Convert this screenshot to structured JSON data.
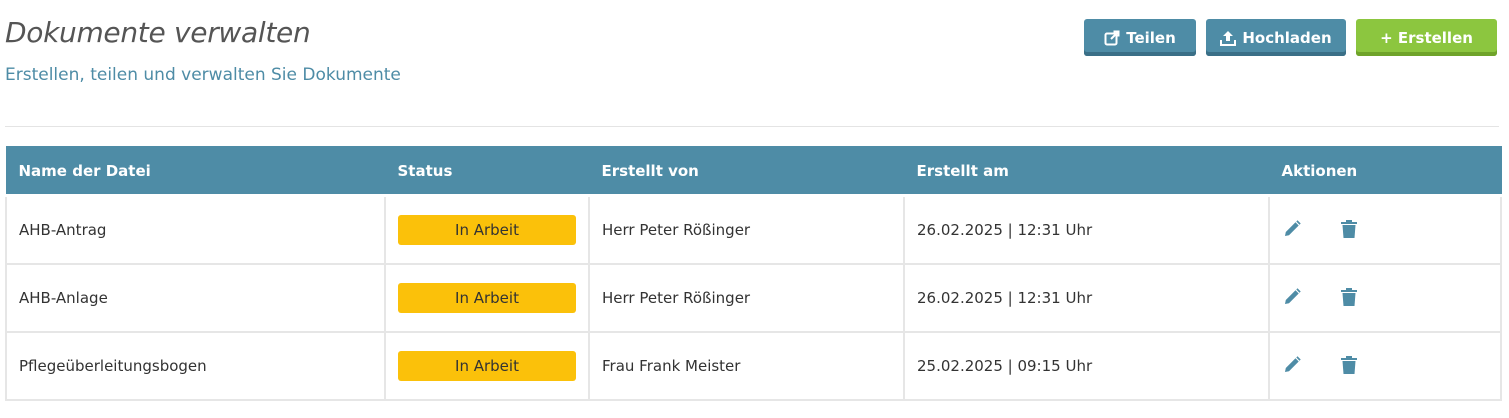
{
  "header": {
    "title": "Dokumente verwalten",
    "subtitle": "Erstellen, teilen und verwalten Sie Dokumente"
  },
  "toolbar": {
    "share_label": "Teilen",
    "upload_label": "Hochladen",
    "create_label": "+ Erstellen"
  },
  "colors": {
    "accent": "#4e8ca6",
    "success": "#8cc63f",
    "status_in_progress": "#fbc10a"
  },
  "table": {
    "columns": [
      "Name der Datei",
      "Status",
      "Erstellt von",
      "Erstellt am",
      "Aktionen"
    ],
    "rows": [
      {
        "name": "AHB-Antrag",
        "status": "In Arbeit",
        "created_by": "Herr Peter Rößinger",
        "created_at": "26.02.2025 | 12:31 Uhr"
      },
      {
        "name": "AHB-Anlage",
        "status": "In Arbeit",
        "created_by": "Herr Peter Rößinger",
        "created_at": "26.02.2025 | 12:31 Uhr"
      },
      {
        "name": "Pflegeüberleitungsbogen",
        "status": "In Arbeit",
        "created_by": "Frau Frank Meister",
        "created_at": "25.02.2025 | 09:15 Uhr"
      }
    ]
  },
  "icons": {
    "share": "share-icon",
    "upload": "upload-icon",
    "edit": "pencil-icon",
    "delete": "trash-icon"
  }
}
